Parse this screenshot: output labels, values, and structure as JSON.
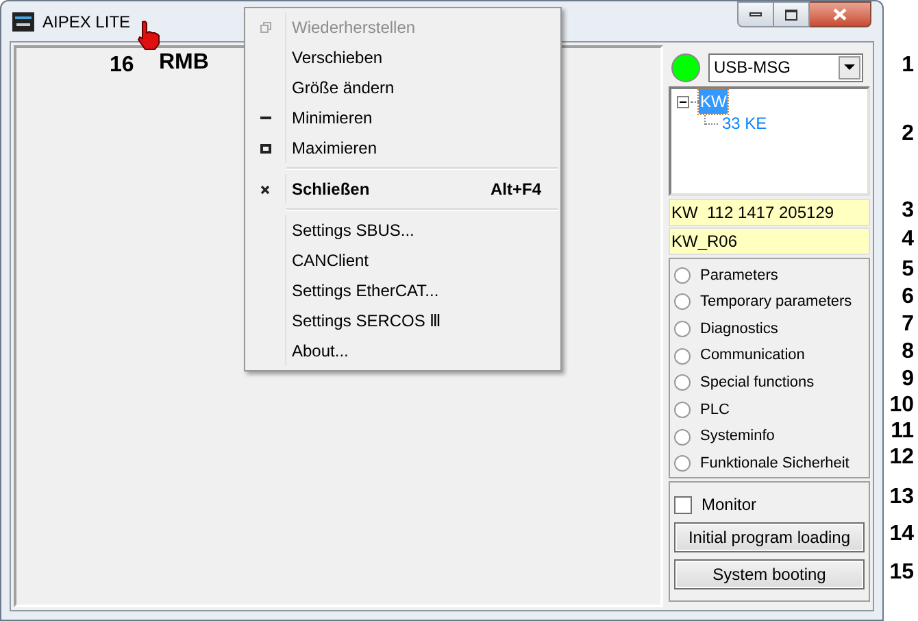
{
  "window": {
    "title": "AIPEX LITE"
  },
  "callouts": [
    "16",
    "RMB"
  ],
  "context_menu": [
    {
      "kind": "restore",
      "label": "Wiederherstellen",
      "disabled": true,
      "default": false
    },
    {
      "kind": "item",
      "label": "Verschieben",
      "disabled": false,
      "default": false
    },
    {
      "kind": "item",
      "label": "Größe ändern",
      "disabled": false,
      "default": false
    },
    {
      "kind": "minimize",
      "label": "Minimieren",
      "disabled": false,
      "default": false
    },
    {
      "kind": "maximize",
      "label": "Maximieren",
      "disabled": false,
      "default": false
    },
    {
      "kind": "separator"
    },
    {
      "kind": "close",
      "label": "Schließen",
      "shortcut": "Alt+F4",
      "disabled": false,
      "default": true
    },
    {
      "kind": "separator"
    },
    {
      "kind": "item",
      "label": "Settings SBUS...",
      "disabled": false,
      "default": false
    },
    {
      "kind": "item",
      "label": "CANClient",
      "disabled": false,
      "default": false
    },
    {
      "kind": "item",
      "label": "Settings EtherCAT...",
      "disabled": false,
      "default": false
    },
    {
      "kind": "item",
      "label": "Settings SERCOS Ⅲ",
      "disabled": false,
      "default": false
    },
    {
      "kind": "item",
      "label": "About...",
      "disabled": false,
      "default": false
    }
  ],
  "connection": {
    "connected": true,
    "interface": "USB-MSG"
  },
  "tree": [
    {
      "label": "KW",
      "selected": true,
      "expanded": true,
      "children": [
        {
          "label": "33 KE",
          "selected": false
        }
      ]
    }
  ],
  "info_fields": [
    "KW  112 1417 205129",
    "KW_R06"
  ],
  "modes": [
    {
      "label": "Parameters",
      "selected": false
    },
    {
      "label": "Temporary parameters",
      "selected": false
    },
    {
      "label": "Diagnostics",
      "selected": false
    },
    {
      "label": "Communication",
      "selected": false
    },
    {
      "label": "Special functions",
      "selected": false
    },
    {
      "label": "PLC",
      "selected": false
    },
    {
      "label": "Systeminfo",
      "selected": false
    },
    {
      "label": "Funktionale Sicherheit",
      "selected": false
    }
  ],
  "monitor": {
    "label": "Monitor",
    "checked": false
  },
  "buttons": [
    "Initial program loading",
    "System booting"
  ],
  "markers": [
    "1",
    "2",
    "3",
    "4",
    "5",
    "6",
    "7",
    "8",
    "9",
    "10",
    "11",
    "12",
    "13",
    "14",
    "15"
  ]
}
